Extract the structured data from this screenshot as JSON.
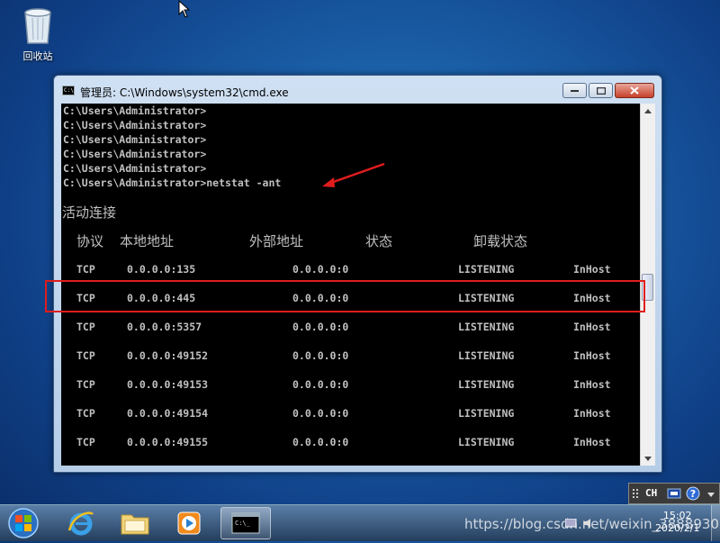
{
  "desktop": {
    "recycle_bin_label": "回收站"
  },
  "window": {
    "title": "管理员: C:\\Windows\\system32\\cmd.exe",
    "app_icon_text": "C:\\"
  },
  "console": {
    "prompt_lines": [
      "C:\\Users\\Administrator>",
      "C:\\Users\\Administrator>",
      "C:\\Users\\Administrator>",
      "C:\\Users\\Administrator>",
      "C:\\Users\\Administrator>",
      "C:\\Users\\Administrator>netstat -ant"
    ],
    "section_title": "活动连接",
    "headers": [
      "协议",
      "本地地址",
      "外部地址",
      "状态",
      "卸载状态"
    ],
    "rows": [
      [
        "TCP",
        "0.0.0.0:135",
        "0.0.0.0:0",
        "LISTENING",
        "InHost"
      ],
      [
        "TCP",
        "0.0.0.0:445",
        "0.0.0.0:0",
        "LISTENING",
        "InHost"
      ],
      [
        "TCP",
        "0.0.0.0:5357",
        "0.0.0.0:0",
        "LISTENING",
        "InHost"
      ],
      [
        "TCP",
        "0.0.0.0:49152",
        "0.0.0.0:0",
        "LISTENING",
        "InHost"
      ],
      [
        "TCP",
        "0.0.0.0:49153",
        "0.0.0.0:0",
        "LISTENING",
        "InHost"
      ],
      [
        "TCP",
        "0.0.0.0:49154",
        "0.0.0.0:0",
        "LISTENING",
        "InHost"
      ],
      [
        "TCP",
        "0.0.0.0:49155",
        "0.0.0.0:0",
        "LISTENING",
        "InHost"
      ]
    ]
  },
  "tray": {
    "language": "CH"
  },
  "taskbar": {
    "time": "15:02",
    "date": "2020/2/1",
    "watermark": "https://blog.csdn.net/weixin_38889300"
  },
  "colors": {
    "annotation_red": "#e01c1c",
    "console_bg": "#000000",
    "console_text": "#c0c0c0"
  }
}
